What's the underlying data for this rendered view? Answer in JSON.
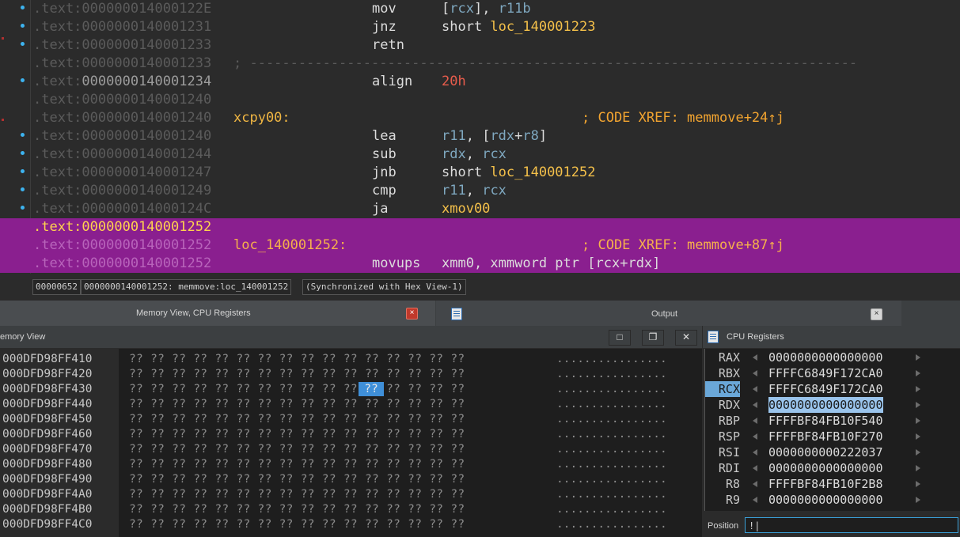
{
  "disasm": {
    "lines": [
      {
        "seg": ".text:",
        "hex": "000000014000122E",
        "label": "",
        "mnem": "mov",
        "op": [
          {
            "t": "[",
            "k": "plain"
          },
          {
            "t": "rcx",
            "k": "reg"
          },
          {
            "t": "], ",
            "k": "plain"
          },
          {
            "t": "r11b",
            "k": "reg"
          }
        ],
        "cmt": "",
        "dot": true,
        "hl": false
      },
      {
        "seg": ".text:",
        "hex": "0000000140001231",
        "label": "",
        "mnem": "jnz",
        "op": [
          {
            "t": "short ",
            "k": "plain"
          },
          {
            "t": "loc_140001223",
            "k": "name"
          }
        ],
        "cmt": "",
        "dot": true,
        "hl": false
      },
      {
        "seg": ".text:",
        "hex": "0000000140001233",
        "label": "",
        "mnem": "retn",
        "op": [],
        "cmt": "",
        "dot": true,
        "hl": false
      },
      {
        "seg": ".text:",
        "hex": "0000000140001233",
        "label": "",
        "mnem": "",
        "op": [],
        "cmt": "",
        "sep": "; ---------------------------------------------------------------------------",
        "dot": false,
        "hl": false
      },
      {
        "seg": ".text:",
        "hex": "0000000140001234",
        "label": "",
        "mnem": "align",
        "op": [
          {
            "t": "20h",
            "k": "num"
          }
        ],
        "cmt": "",
        "dot": true,
        "hl": false,
        "bright": true
      },
      {
        "seg": ".text:",
        "hex": "0000000140001240",
        "label": "",
        "mnem": "",
        "op": [],
        "cmt": "",
        "dot": false,
        "hl": false
      },
      {
        "seg": ".text:",
        "hex": "0000000140001240",
        "label": "xcpy00:",
        "mnem": "",
        "op": [],
        "cmt": "; CODE XREF: memmove+24↑j",
        "dot": false,
        "hl": false
      },
      {
        "seg": ".text:",
        "hex": "0000000140001240",
        "label": "",
        "mnem": "lea",
        "op": [
          {
            "t": "r11",
            "k": "reg"
          },
          {
            "t": ", [",
            "k": "plain"
          },
          {
            "t": "rdx",
            "k": "reg"
          },
          {
            "t": "+",
            "k": "plain"
          },
          {
            "t": "r8",
            "k": "reg"
          },
          {
            "t": "]",
            "k": "plain"
          }
        ],
        "cmt": "",
        "dot": true,
        "hl": false
      },
      {
        "seg": ".text:",
        "hex": "0000000140001244",
        "label": "",
        "mnem": "sub",
        "op": [
          {
            "t": "rdx",
            "k": "reg"
          },
          {
            "t": ", ",
            "k": "plain"
          },
          {
            "t": "rcx",
            "k": "reg"
          }
        ],
        "cmt": "",
        "dot": true,
        "hl": false
      },
      {
        "seg": ".text:",
        "hex": "0000000140001247",
        "label": "",
        "mnem": "jnb",
        "op": [
          {
            "t": "short ",
            "k": "plain"
          },
          {
            "t": "loc_140001252",
            "k": "name"
          }
        ],
        "cmt": "",
        "dot": true,
        "hl": false
      },
      {
        "seg": ".text:",
        "hex": "0000000140001249",
        "label": "",
        "mnem": "cmp",
        "op": [
          {
            "t": "r11",
            "k": "reg"
          },
          {
            "t": ", ",
            "k": "plain"
          },
          {
            "t": "rcx",
            "k": "reg"
          }
        ],
        "cmt": "",
        "dot": true,
        "hl": false
      },
      {
        "seg": ".text:",
        "hex": "000000014000124C",
        "label": "",
        "mnem": "ja",
        "op": [
          {
            "t": "xmov00",
            "k": "name"
          }
        ],
        "cmt": "",
        "dot": true,
        "hl": false
      },
      {
        "seg": ".text:",
        "hex": "0000000140001252",
        "label": "",
        "mnem": "",
        "op": [],
        "cmt": "",
        "dot": false,
        "hl": true,
        "cur": true
      },
      {
        "seg": ".text:",
        "hex": "0000000140001252",
        "label": "loc_140001252:",
        "mnem": "",
        "op": [],
        "cmt": "; CODE XREF: memmove+87↑j",
        "dot": false,
        "hl": true
      },
      {
        "seg": ".text:",
        "hex": "0000000140001252",
        "label": "",
        "mnem": "movups",
        "op": [
          {
            "t": "xmm0",
            "k": "reg"
          },
          {
            "t": ", xmmword ptr [",
            "k": "plain"
          },
          {
            "t": "rcx",
            "k": "reg"
          },
          {
            "t": "+",
            "k": "plain"
          },
          {
            "t": "rdx",
            "k": "reg"
          },
          {
            "t": "]",
            "k": "plain"
          }
        ],
        "cmt": "",
        "dot": false,
        "hl": true
      }
    ]
  },
  "status": {
    "offset": "00000652",
    "location": "0000000140001252: memmove:loc_140001252",
    "sync": "(Synchronized with Hex View-1)"
  },
  "tabs": {
    "memory_cpu": "Memory View, CPU Registers",
    "output": "Output",
    "close_glyph": "×"
  },
  "memory": {
    "title": "emory View",
    "win_buttons": [
      "□",
      "❐",
      "✕"
    ],
    "rows": [
      {
        "addr": "000DFD98FF410",
        "bytes": "?? ?? ?? ?? ?? ?? ?? ?? ?? ?? ?? ?? ?? ?? ?? ??",
        "ascii": "................"
      },
      {
        "addr": "000DFD98FF420",
        "bytes": "?? ?? ?? ?? ?? ?? ?? ?? ?? ?? ?? ?? ?? ?? ?? ??",
        "ascii": "................"
      },
      {
        "addr": "000DFD98FF430",
        "bytes": "?? ?? ?? ?? ?? ?? ?? ?? ?? ?? ?? ?? ?? ?? ?? ??",
        "ascii": "................"
      },
      {
        "addr": "000DFD98FF440",
        "bytes": "?? ?? ?? ?? ?? ?? ?? ?? ?? ?? ?? ?? ?? ?? ?? ??",
        "ascii": "................"
      },
      {
        "addr": "000DFD98FF450",
        "bytes": "?? ?? ?? ?? ?? ?? ?? ?? ?? ?? ?? ?? ?? ?? ?? ??",
        "ascii": "................"
      },
      {
        "addr": "000DFD98FF460",
        "bytes": "?? ?? ?? ?? ?? ?? ?? ?? ?? ?? ?? ?? ?? ?? ?? ??",
        "ascii": "................"
      },
      {
        "addr": "000DFD98FF470",
        "bytes": "?? ?? ?? ?? ?? ?? ?? ?? ?? ?? ?? ?? ?? ?? ?? ??",
        "ascii": "................"
      },
      {
        "addr": "000DFD98FF480",
        "bytes": "?? ?? ?? ?? ?? ?? ?? ?? ?? ?? ?? ?? ?? ?? ?? ??",
        "ascii": "................"
      },
      {
        "addr": "000DFD98FF490",
        "bytes": "?? ?? ?? ?? ?? ?? ?? ?? ?? ?? ?? ?? ?? ?? ?? ??",
        "ascii": "................"
      },
      {
        "addr": "000DFD98FF4A0",
        "bytes": "?? ?? ?? ?? ?? ?? ?? ?? ?? ?? ?? ?? ?? ?? ?? ??",
        "ascii": "................"
      },
      {
        "addr": "000DFD98FF4B0",
        "bytes": "?? ?? ?? ?? ?? ?? ?? ?? ?? ?? ?? ?? ?? ?? ?? ??",
        "ascii": "................"
      },
      {
        "addr": "000DFD98FF4C0",
        "bytes": "?? ?? ?? ?? ?? ?? ?? ?? ?? ?? ?? ?? ?? ?? ?? ??",
        "ascii": "................"
      }
    ],
    "selected_byte": "??"
  },
  "cpu": {
    "title": "CPU Registers",
    "registers": [
      {
        "name": "RAX",
        "value": "0000000000000000"
      },
      {
        "name": "RBX",
        "value": "FFFFC6849F172CA0"
      },
      {
        "name": "RCX",
        "value": "FFFFC6849F172CA0",
        "sel_name": true
      },
      {
        "name": "RDX",
        "value": "0000000000000000",
        "sel_val": true
      },
      {
        "name": "RBP",
        "value": "FFFFBF84FB10F540"
      },
      {
        "name": "RSP",
        "value": "FFFFBF84FB10F270"
      },
      {
        "name": "RSI",
        "value": "0000000000222037"
      },
      {
        "name": "RDI",
        "value": "0000000000000000"
      },
      {
        "name": "R8",
        "value": "FFFFBF84FB10F2B8"
      },
      {
        "name": "R9",
        "value": "0000000000000000"
      }
    ],
    "position_label": "Position",
    "position_value": "!|"
  },
  "colors": {
    "highlight": "#8a1f8f",
    "label": "#f0b643",
    "register": "#7fa8c0",
    "number": "#e85c4c"
  }
}
